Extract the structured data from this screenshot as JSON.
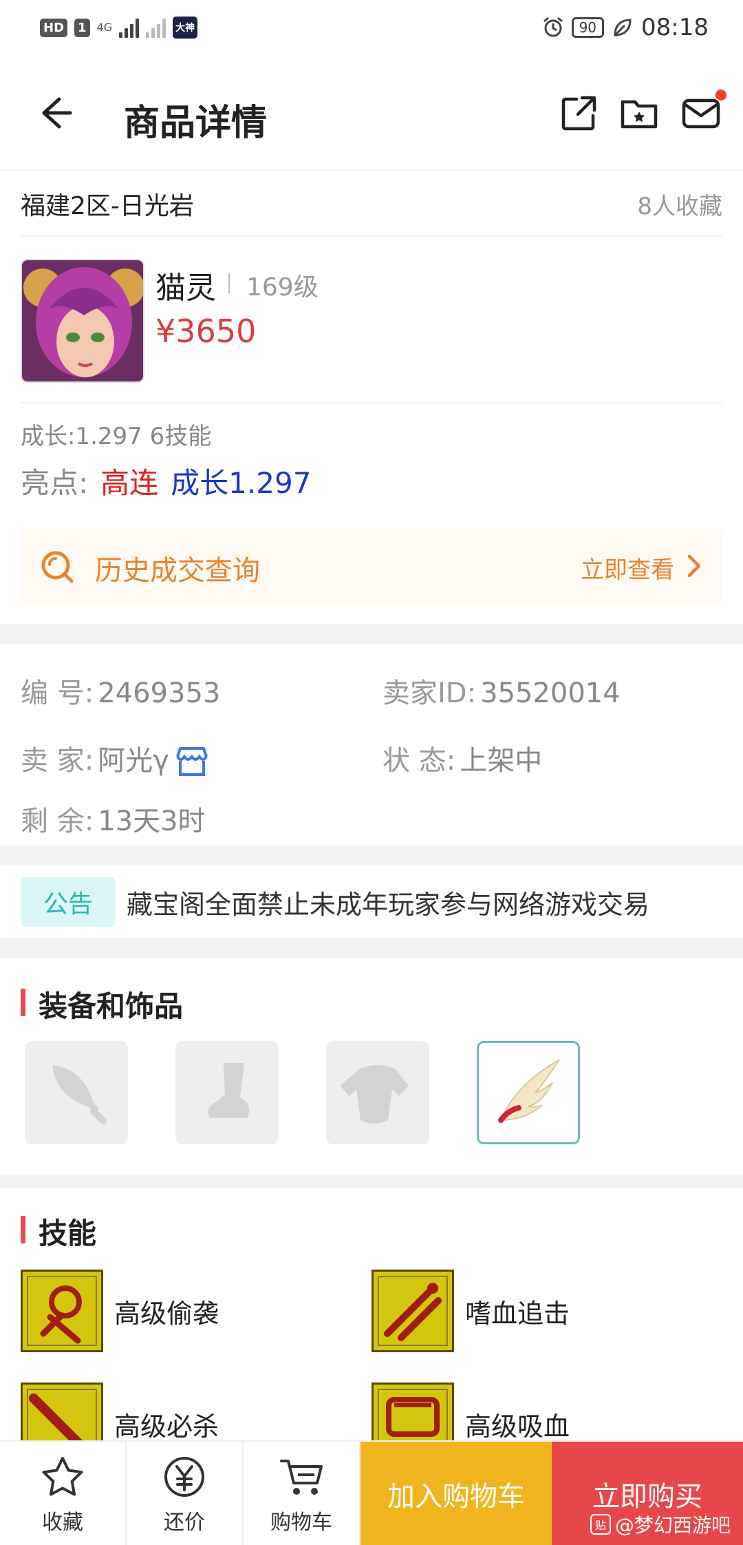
{
  "status_bar": {
    "hd": "HD",
    "sim": "1",
    "net": "4G",
    "app_badge": "大神",
    "battery": "90",
    "time": "08:18"
  },
  "header": {
    "title": "商品详情",
    "icons": [
      "back-arrow-icon",
      "share-icon",
      "folder-star-icon",
      "mail-icon"
    ]
  },
  "server": {
    "name": "福建2区-日光岩",
    "favorites": "8人收藏"
  },
  "product": {
    "name": "猫灵",
    "level": "169级",
    "price": "¥3650",
    "growth_skills": "成长:1.297 6技能",
    "highlight_label": "亮点:",
    "highlight_red": "高连",
    "highlight_blue": "成长1.297"
  },
  "history": {
    "label": "历史成交查询",
    "action": "立即查看"
  },
  "info": {
    "id_label": "编  号:",
    "id_value": "2469353",
    "seller_id_label": "卖家ID:",
    "seller_id_value": "35520014",
    "seller_label": "卖  家:",
    "seller_value": "阿光γ",
    "status_label": "状  态:",
    "status_value": "上架中",
    "remaining_label": "剩  余:",
    "remaining_value": "13天3时"
  },
  "notice": {
    "badge": "公告",
    "text": "藏宝阁全面禁止未成年玩家参与网络游戏交易"
  },
  "equipment": {
    "title": "装备和饰品",
    "slots": [
      "weapon-slot-icon",
      "boots-slot-icon",
      "armor-slot-icon",
      "wing-ornament-icon"
    ]
  },
  "skills": {
    "title": "技能",
    "items": [
      "高级偷袭",
      "嗜血追击",
      "高级必杀",
      "高级吸血"
    ]
  },
  "bottom": {
    "favorite": "收藏",
    "bargain": "还价",
    "cart": "购物车",
    "add_cart": "加入购物车",
    "buy_now": "立即购买",
    "watermark": "@梦幻西游吧"
  },
  "colors": {
    "price": "#d63f3f",
    "accent_orange": "#e8822e",
    "cart_btn": "#f0b51e",
    "buy_btn": "#e8474a",
    "notice_teal": "#33b5b0"
  }
}
